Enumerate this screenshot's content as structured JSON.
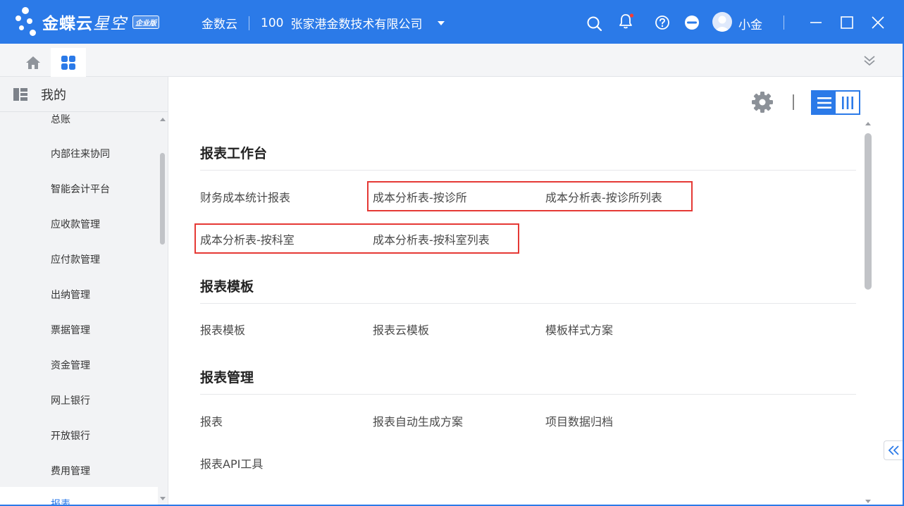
{
  "titlebar": {
    "logo_text": "金蝶云",
    "logo_text_b": "星空",
    "edition_badge": "企业版",
    "app_name": "金数云",
    "org_code": "100",
    "org_name": "张家港金数技术有限公司",
    "user_name": "小金",
    "notification_dot_color": "#ff3b30"
  },
  "sidebar": {
    "header": "我的",
    "items": [
      {
        "label": "总账"
      },
      {
        "label": "内部往来协同"
      },
      {
        "label": "智能会计平台"
      },
      {
        "label": "应收款管理"
      },
      {
        "label": "应付款管理"
      },
      {
        "label": "出纳管理"
      },
      {
        "label": "票据管理"
      },
      {
        "label": "资金管理"
      },
      {
        "label": "网上银行"
      },
      {
        "label": "开放银行"
      },
      {
        "label": "费用管理"
      },
      {
        "label": "报表"
      }
    ]
  },
  "sections": [
    {
      "title": "报表工作台",
      "links": [
        "财务成本统计报表",
        "成本分析表-按诊所",
        "成本分析表-按诊所列表",
        "成本分析表-按科室",
        "成本分析表-按科室列表"
      ]
    },
    {
      "title": "报表模板",
      "links": [
        "报表模板",
        "报表云模板",
        "模板样式方案"
      ]
    },
    {
      "title": "报表管理",
      "links": [
        "报表",
        "报表自动生成方案",
        "项目数据归档",
        "报表API工具"
      ]
    }
  ],
  "colors": {
    "brand_blue": "#2b7ae8",
    "highlight_red": "#e53935"
  }
}
